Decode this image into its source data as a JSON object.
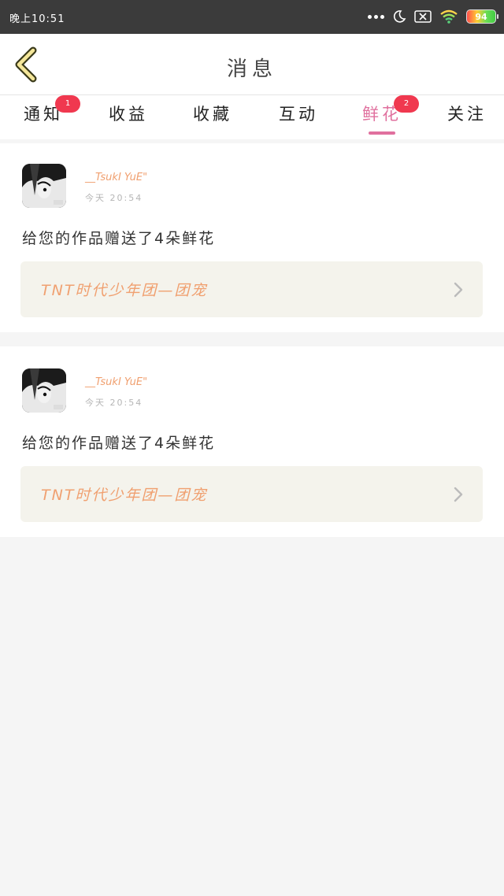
{
  "status_bar": {
    "time": "晚上10:51",
    "battery": "94"
  },
  "header": {
    "title": "消息"
  },
  "tabs": [
    {
      "label": "通知",
      "badge": "1"
    },
    {
      "label": "收益",
      "badge": ""
    },
    {
      "label": "收藏",
      "badge": ""
    },
    {
      "label": "互动",
      "badge": ""
    },
    {
      "label": "鲜花",
      "badge": "2",
      "active": true
    },
    {
      "label": "关注",
      "badge": ""
    }
  ],
  "notifications": [
    {
      "username": "__TsukI YuE\"",
      "time": "今天 20:54",
      "message": "给您的作品赠送了4朵鲜花",
      "work_title": "TNT时代少年团—团宠"
    },
    {
      "username": "__TsukI YuE\"",
      "time": "今天 20:54",
      "message": "给您的作品赠送了4朵鲜花",
      "work_title": "TNT时代少年团—团宠"
    }
  ],
  "colors": {
    "accent": "#e0709e",
    "badge": "#f0384f",
    "username": "#f0a070",
    "status_bar": "#3b3b3b"
  }
}
